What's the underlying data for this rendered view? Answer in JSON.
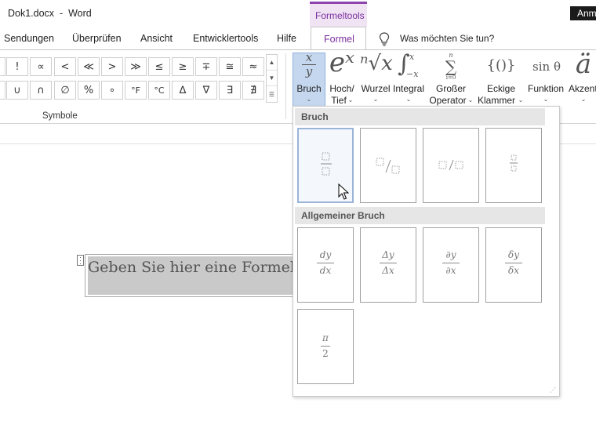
{
  "window": {
    "doc_title": "Dok1.docx  -  Word",
    "contextual_tab": "Formeltools",
    "account_label": "Anm"
  },
  "tabs": [
    "Sendungen",
    "Überprüfen",
    "Ansicht",
    "Entwicklertools",
    "Hilfe",
    "Formel"
  ],
  "tell_me": "Was möchten Sie tun?",
  "symbols": {
    "row1": [
      "!",
      "∝",
      "<",
      "≪",
      ">",
      "≫",
      "≤",
      "≥",
      "∓",
      "≅",
      "≈"
    ],
    "row2": [
      "∪",
      "∩",
      "∅",
      "%",
      "∘",
      "°F",
      "°C",
      "∆",
      "∇",
      "∃",
      "∄"
    ],
    "group_label": "Symbole"
  },
  "ribbon_buttons": [
    {
      "icon_top": "x",
      "icon_bottom": "y",
      "label": "Bruch",
      "label2": ""
    },
    {
      "icon": "eˣ",
      "label": "Hoch/",
      "label2": "Tief"
    },
    {
      "icon": "ⁿ√x",
      "label": "Wurzel",
      "label2": ""
    },
    {
      "icon": "∫",
      "label": "Integral",
      "label2": ""
    },
    {
      "icon": "∑",
      "label": "Großer",
      "label2": "Operator"
    },
    {
      "icon": "{()}",
      "label": "Eckige",
      "label2": "Klammer"
    },
    {
      "icon": "sin θ",
      "label": "Funktion",
      "label2": ""
    },
    {
      "icon": "ä",
      "label": "Akzent",
      "label2": ""
    }
  ],
  "integral_limits": {
    "upper": "x",
    "lower": "−x"
  },
  "sum_limits": {
    "upper": "n",
    "lower": "i=0"
  },
  "document": {
    "placeholder": "Geben Sie hier eine Formel ein."
  },
  "gallery": {
    "section1": "Bruch",
    "section2": "Allgemeiner Bruch",
    "general": [
      {
        "num": "dy",
        "den": "dx"
      },
      {
        "num": "Δy",
        "den": "Δx"
      },
      {
        "num": "∂y",
        "den": "∂x"
      },
      {
        "num": "δy",
        "den": "δx"
      },
      {
        "num": "π",
        "den": "2"
      }
    ]
  }
}
